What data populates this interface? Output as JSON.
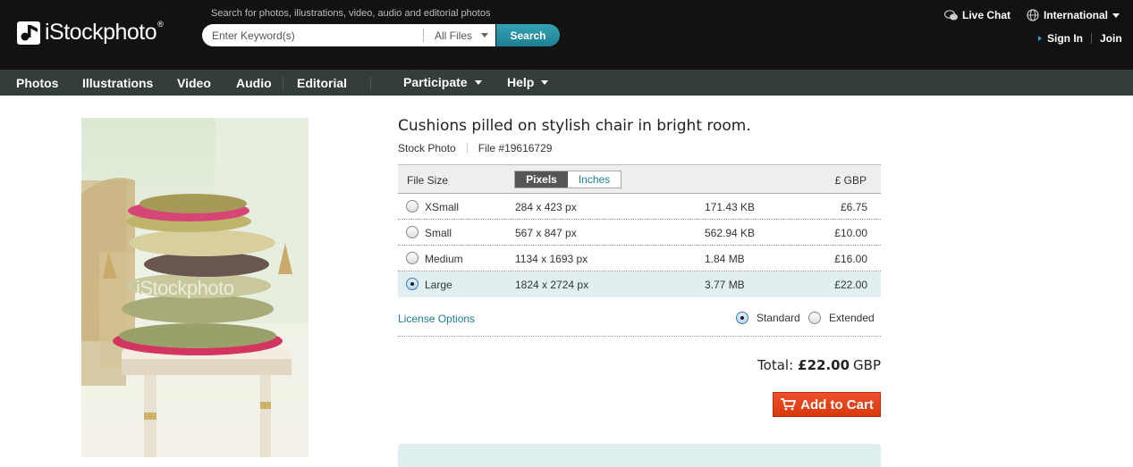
{
  "header": {
    "logo_text": "iStockphoto",
    "logo_mark": "®",
    "search_caption": "Search for photos, illustrations, video, audio and editorial photos",
    "search_placeholder": "Enter Keyword(s)",
    "filter_value": "All Files",
    "search_button": "Search",
    "live_chat": "Live Chat",
    "international": "International",
    "sign_in": "Sign In",
    "join": "Join"
  },
  "nav": {
    "items": [
      "Photos",
      "Illustrations",
      "Video",
      "Audio",
      "Editorial"
    ],
    "menus": [
      "Participate",
      "Help"
    ]
  },
  "preview": {
    "watermark": "iStockphoto"
  },
  "file": {
    "title": "Cushions pilled on stylish chair in bright room.",
    "type": "Stock Photo",
    "number": "File #19616729"
  },
  "sizes": {
    "header_label": "File Size",
    "unit_selected": "Pixels",
    "unit_other": "Inches",
    "currency_label": "£ GBP",
    "rows": [
      {
        "name": "XSmall",
        "dims": "284 x 423 px",
        "filesize": "171.43 KB",
        "price": "£6.75",
        "selected": false
      },
      {
        "name": "Small",
        "dims": "567 x 847 px",
        "filesize": "562.94 KB",
        "price": "£10.00",
        "selected": false
      },
      {
        "name": "Medium",
        "dims": "1134 x 1693 px",
        "filesize": "1.84 MB",
        "price": "£16.00",
        "selected": false
      },
      {
        "name": "Large",
        "dims": "1824 x 2724 px",
        "filesize": "3.77 MB",
        "price": "£22.00",
        "selected": true
      }
    ]
  },
  "license": {
    "link": "License Options",
    "standard": "Standard",
    "extended": "Extended",
    "selected": "Standard"
  },
  "total": {
    "label": "Total:",
    "amount": "£22.00",
    "currency": "GBP"
  },
  "cart": {
    "button": "Add to Cart"
  },
  "colors": {
    "topbar": "#121212",
    "navbar": "#343c3c",
    "accent": "#1d7f92",
    "cart": "#e5421a",
    "selected_row": "#e2eff0"
  }
}
